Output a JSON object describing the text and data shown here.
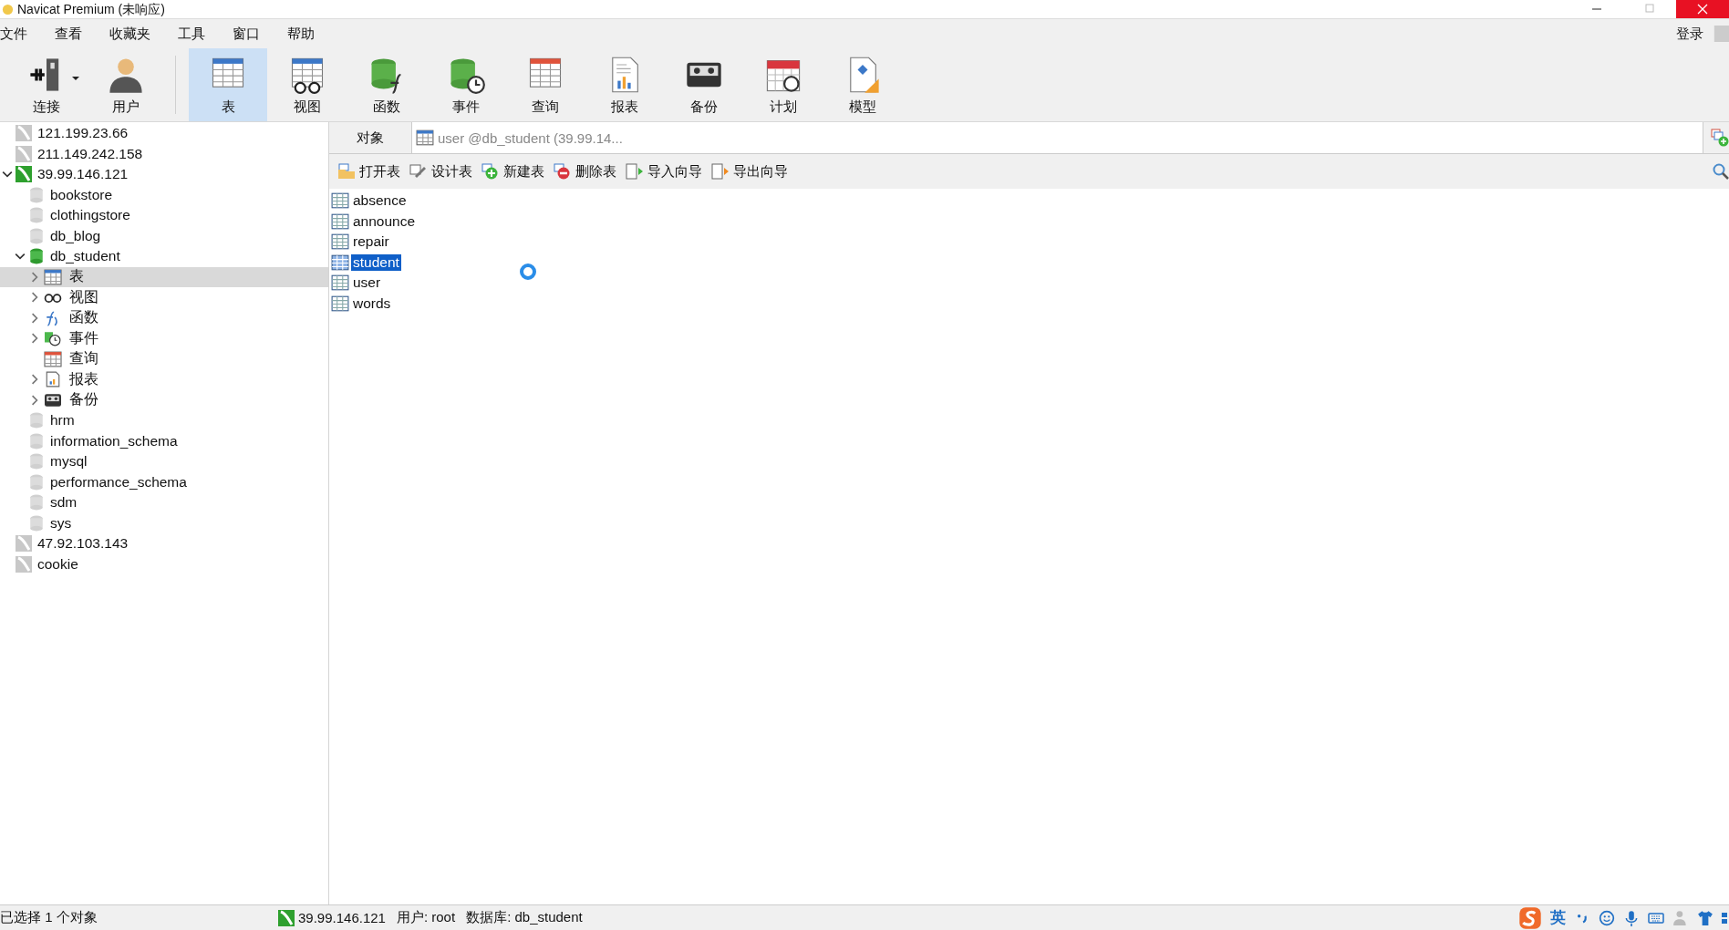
{
  "window": {
    "title": "Navicat Premium (未响应)"
  },
  "menu": [
    "文件",
    "查看",
    "收藏夹",
    "工具",
    "窗口",
    "帮助"
  ],
  "login": "登录",
  "toolbar": [
    {
      "label": "连接",
      "kind": "connection",
      "selected": false,
      "dropdown": true
    },
    {
      "label": "用户",
      "kind": "user",
      "selected": false,
      "dropdown": false
    },
    {
      "label": "表",
      "kind": "table",
      "selected": true,
      "dropdown": false
    },
    {
      "label": "视图",
      "kind": "view",
      "selected": false,
      "dropdown": false
    },
    {
      "label": "函数",
      "kind": "function",
      "selected": false,
      "dropdown": false
    },
    {
      "label": "事件",
      "kind": "event",
      "selected": false,
      "dropdown": false
    },
    {
      "label": "查询",
      "kind": "query",
      "selected": false,
      "dropdown": false
    },
    {
      "label": "报表",
      "kind": "report",
      "selected": false,
      "dropdown": false
    },
    {
      "label": "备份",
      "kind": "backup",
      "selected": false,
      "dropdown": false
    },
    {
      "label": "计划",
      "kind": "schedule",
      "selected": false,
      "dropdown": false
    },
    {
      "label": "模型",
      "kind": "model",
      "selected": false,
      "dropdown": false
    }
  ],
  "sidebar": {
    "connections": [
      {
        "label": "121.199.23.66",
        "connected": false
      },
      {
        "label": "211.149.242.158",
        "connected": false
      },
      {
        "label": "39.99.146.121",
        "connected": true,
        "expanded": true,
        "children": [
          {
            "label": "bookstore",
            "open": false
          },
          {
            "label": "clothingstore",
            "open": false
          },
          {
            "label": "db_blog",
            "open": false
          },
          {
            "label": "db_student",
            "open": true,
            "expanded": true,
            "children": [
              {
                "label": "表",
                "kind": "table",
                "expandable": true,
                "selected": true
              },
              {
                "label": "视图",
                "kind": "view",
                "expandable": true,
                "selected": false
              },
              {
                "label": "函数",
                "kind": "function",
                "expandable": true,
                "selected": false
              },
              {
                "label": "事件",
                "kind": "event",
                "expandable": true,
                "selected": false
              },
              {
                "label": "查询",
                "kind": "query",
                "expandable": false,
                "selected": false
              },
              {
                "label": "报表",
                "kind": "report",
                "expandable": true,
                "selected": false
              },
              {
                "label": "备份",
                "kind": "backup",
                "expandable": true,
                "selected": false
              }
            ]
          },
          {
            "label": "hrm",
            "open": false
          },
          {
            "label": "information_schema",
            "open": false
          },
          {
            "label": "mysql",
            "open": false
          },
          {
            "label": "performance_schema",
            "open": false
          },
          {
            "label": "sdm",
            "open": false
          },
          {
            "label": "sys",
            "open": false
          }
        ]
      },
      {
        "label": "47.92.103.143",
        "connected": false
      },
      {
        "label": "cookie",
        "connected": false
      }
    ]
  },
  "tabs": [
    {
      "label": "对象",
      "kind": "objects",
      "selected": true
    },
    {
      "label": "user @db_student (39.99.14...",
      "kind": "table",
      "selected": false
    }
  ],
  "actions": [
    {
      "label": "打开表",
      "kind": "open"
    },
    {
      "label": "设计表",
      "kind": "design"
    },
    {
      "label": "新建表",
      "kind": "new"
    },
    {
      "label": "删除表",
      "kind": "delete"
    },
    {
      "label": "导入向导",
      "kind": "import"
    },
    {
      "label": "导出向导",
      "kind": "export"
    }
  ],
  "tables": [
    {
      "name": "absence",
      "selected": false
    },
    {
      "name": "announce",
      "selected": false
    },
    {
      "name": "repair",
      "selected": false
    },
    {
      "name": "student",
      "selected": true
    },
    {
      "name": "user",
      "selected": false
    },
    {
      "name": "words",
      "selected": false
    }
  ],
  "status_bar": {
    "selection": "已选择 1 个对象",
    "connection": "39.99.146.121",
    "user": "用户: root",
    "database": "数据库: db_student"
  },
  "tray": {
    "language": "英"
  }
}
